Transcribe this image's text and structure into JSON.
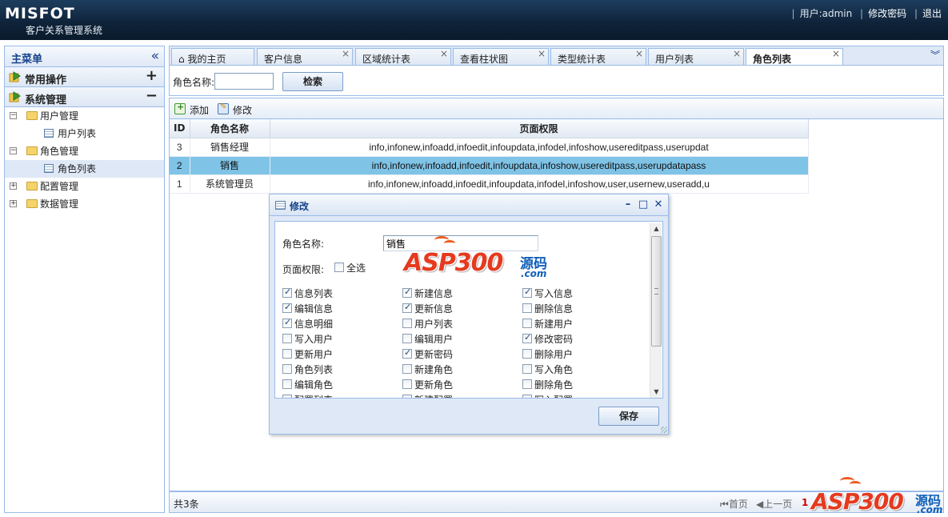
{
  "header": {
    "brand": "MISFOT",
    "subtitle": "客户关系管理系统",
    "user_label": "用户:admin",
    "change_password": "修改密码",
    "logout": "退出"
  },
  "sidebar": {
    "title": "主菜单",
    "sections": [
      {
        "label": "常用操作",
        "toggle": "+"
      },
      {
        "label": "系统管理",
        "toggle": "−"
      }
    ],
    "tree": [
      {
        "label": "用户管理",
        "exp": "−"
      },
      {
        "label": "用户列表"
      },
      {
        "label": "角色管理",
        "exp": "−"
      },
      {
        "label": "角色列表"
      },
      {
        "label": "配置管理",
        "exp": "+"
      },
      {
        "label": "数据管理",
        "exp": "+"
      }
    ]
  },
  "tabs": [
    {
      "label": "我的主页"
    },
    {
      "label": "客户信息"
    },
    {
      "label": "区域统计表"
    },
    {
      "label": "查看柱状图"
    },
    {
      "label": "类型统计表"
    },
    {
      "label": "用户列表"
    },
    {
      "label": "角色列表"
    }
  ],
  "tab_close": "×",
  "search": {
    "label": "角色名称:",
    "value": "",
    "button": "检索"
  },
  "toolbar": {
    "add": "添加",
    "edit": "修改"
  },
  "grid": {
    "columns": [
      "ID",
      "角色名称",
      "页面权限"
    ],
    "rows": [
      [
        "3",
        "销售经理",
        "info,infonew,infoadd,infoedit,infoupdata,infodel,infoshow,usereditpass,userupdat"
      ],
      [
        "2",
        "销售",
        "info,infonew,infoadd,infoedit,infoupdata,infoshow,usereditpass,userupdatapass"
      ],
      [
        "1",
        "系统管理员",
        "info,infonew,infoadd,infoedit,infoupdata,infodel,infoshow,user,usernew,useradd,u"
      ]
    ],
    "selected_row": 1
  },
  "pager": {
    "total": "共3条",
    "first": "首页",
    "prev": "上一页",
    "current": "1"
  },
  "dialog": {
    "title": "修改",
    "name_label": "角色名称:",
    "name_value": "销售",
    "perm_label": "页面权限:",
    "select_all": "全选",
    "save": "保存",
    "permissions": [
      [
        {
          "label": "信息列表",
          "checked": true
        },
        {
          "label": "新建信息",
          "checked": true
        },
        {
          "label": "写入信息",
          "checked": true
        }
      ],
      [
        {
          "label": "编辑信息",
          "checked": true
        },
        {
          "label": "更新信息",
          "checked": true
        },
        {
          "label": "删除信息",
          "checked": false
        }
      ],
      [
        {
          "label": "信息明细",
          "checked": true
        },
        {
          "label": "用户列表",
          "checked": false
        },
        {
          "label": "新建用户",
          "checked": false
        }
      ],
      [
        {
          "label": "写入用户",
          "checked": false
        },
        {
          "label": "编辑用户",
          "checked": false
        },
        {
          "label": "修改密码",
          "checked": true
        }
      ],
      [
        {
          "label": "更新用户",
          "checked": false
        },
        {
          "label": "更新密码",
          "checked": true
        },
        {
          "label": "删除用户",
          "checked": false
        }
      ],
      [
        {
          "label": "角色列表",
          "checked": false
        },
        {
          "label": "新建角色",
          "checked": false
        },
        {
          "label": "写入角色",
          "checked": false
        }
      ],
      [
        {
          "label": "编辑角色",
          "checked": false
        },
        {
          "label": "更新角色",
          "checked": false
        },
        {
          "label": "删除角色",
          "checked": false
        }
      ],
      [
        {
          "label": "配置列表",
          "checked": false
        },
        {
          "label": "新建配置",
          "checked": false
        },
        {
          "label": "写入配置",
          "checked": false
        }
      ]
    ]
  },
  "watermark": {
    "text": "ASP300",
    "cn": "源码",
    "domain": ".com"
  },
  "colors": {
    "header_bg": "#0e2238",
    "border": "#99bbe8",
    "selected_row": "#7fc3e6",
    "watermark_red": "#e53a1f",
    "watermark_blue": "#0f5fb8"
  }
}
